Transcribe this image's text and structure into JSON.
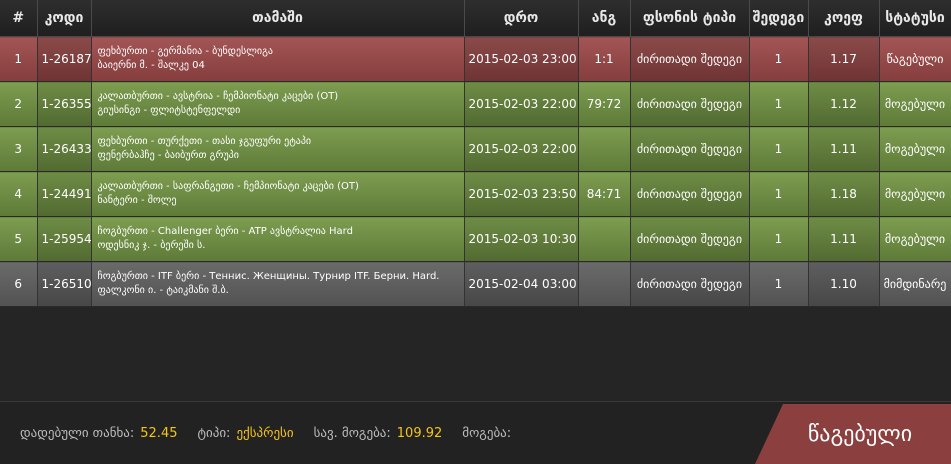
{
  "headers": {
    "num": "#",
    "code": "კოდი",
    "game": "თამაში",
    "date": "დრო",
    "score": "ანგ",
    "bet_type": "ფსონის ტიპი",
    "result": "შედეგი",
    "coef": "კოეფ",
    "status": "სტატუსი"
  },
  "rows": [
    {
      "num": "1",
      "code": "1-26187",
      "game_line1": "ფეხბურთი - გერმანია - ბუნდესლიგა",
      "game_line2": "ბაიერნი მ. - შალკე 04",
      "date": "2015-02-03 23:00",
      "score": "1:1",
      "bet_type": "ძირითადი შედეგი",
      "result": "1",
      "coef": "1.17",
      "status": "წაგებული",
      "state": "lost"
    },
    {
      "num": "2",
      "code": "1-26355",
      "game_line1": "კალათბურთი - ავსტრია - ჩემპიონატი კაცები (OT)",
      "game_line2": "გიუსინგი - ფლიტსტენფელდი",
      "date": "2015-02-03 22:00",
      "score": "79:72",
      "bet_type": "ძირითადი შედეგი",
      "result": "1",
      "coef": "1.12",
      "status": "მოგებული",
      "state": "won"
    },
    {
      "num": "3",
      "code": "1-26433",
      "game_line1": "ფეხბურთი - თურქეთი - თასი ჯგუფური ეტაპი",
      "game_line2": "ფენერბაჰჩე - ბაიბურთ გრუპი",
      "date": "2015-02-03 22:00",
      "score": "",
      "bet_type": "ძირითადი შედეგი",
      "result": "1",
      "coef": "1.11",
      "status": "მოგებული",
      "state": "won"
    },
    {
      "num": "4",
      "code": "1-24491",
      "game_line1": "კალათბურთი - საფრანგეთი - ჩემპიონატი კაცები (OT)",
      "game_line2": "ნანტერი - შოლე",
      "date": "2015-02-03 23:50",
      "score": "84:71",
      "bet_type": "ძირითადი შედეგი",
      "result": "1",
      "coef": "1.18",
      "status": "მოგებული",
      "state": "won"
    },
    {
      "num": "5",
      "code": "1-25954",
      "game_line1": "ჩოგბურთი - Challenger ბერი - ATP ავსტრალია Hard",
      "game_line2": "ოდესნიკ ჯ. - ბერეში ს.",
      "date": "2015-02-03 10:30",
      "score": "",
      "bet_type": "ძირითადი შედეგი",
      "result": "1",
      "coef": "1.11",
      "status": "მოგებული",
      "state": "won"
    },
    {
      "num": "6",
      "code": "1-26510",
      "game_line1": "ჩოგბურთი - ITF ბერი - Теннис. Женщины. Турнир ITF. Берни. Hard.",
      "game_line2": "ფალკონი ი. - ტაიკმანი შ.ბ.",
      "date": "2015-02-04 03:00",
      "score": "",
      "bet_type": "ძირითადი შედეგი",
      "result": "1",
      "coef": "1.10",
      "status": "მიმდინარე",
      "state": "void"
    }
  ],
  "footer": {
    "stake_label": "დადებული თანხა:",
    "stake_value": "52.45",
    "type_label": "ტიპი:",
    "type_value": "ექსპრესი",
    "potential_label": "სავ. მოგება:",
    "potential_value": "109.92",
    "win_label": "მოგება:",
    "win_value": "",
    "status_badge": "წაგებული"
  },
  "colors": {
    "lost": "#8b4a4a",
    "won": "#6e8c45",
    "pending": "#5e5e5e",
    "accent_yellow": "#f5c518",
    "badge": "#8c3f3f"
  }
}
